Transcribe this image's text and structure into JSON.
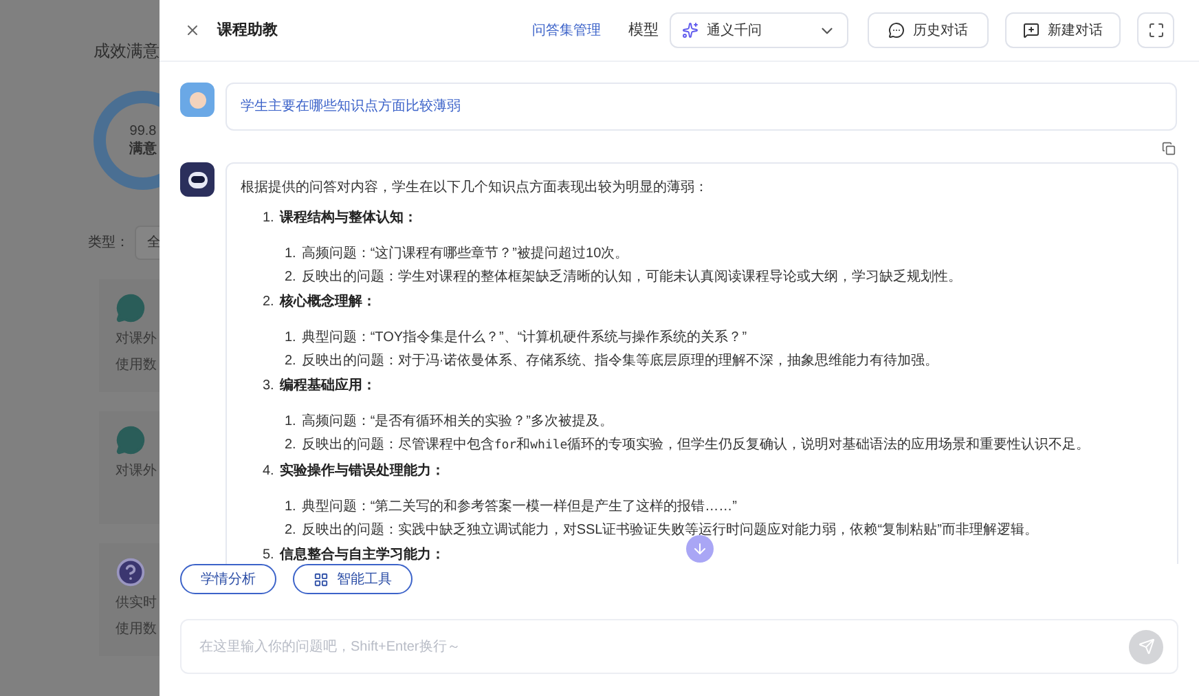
{
  "background_page": {
    "title": "成效满意",
    "donut_value": "99.8",
    "donut_label": "满意",
    "filter_label": "类型：",
    "filter_value": "全",
    "cards": [
      {
        "kind": "bot",
        "text": "对课外",
        "usage": "使用数"
      },
      {
        "kind": "bot",
        "text": "对课外"
      },
      {
        "kind": "question",
        "text": "供实时",
        "usage": "使用数"
      }
    ]
  },
  "drawer": {
    "title": "课程助教",
    "qa_link": "问答集管理",
    "model_label": "模型",
    "model": "通义千问",
    "history_button": "历史对话",
    "new_button": "新建对话"
  },
  "question": {
    "text": "学生主要在哪些知识点方面比较薄弱"
  },
  "answer": {
    "intro": "根据提供的问答对内容，学生在以下几个知识点方面表现出较为明显的薄弱：",
    "sections": [
      {
        "marker": "1.",
        "title": "课程结构与整体认知：",
        "children": [
          {
            "marker": "1.",
            "parts": [
              {
                "kind": "text",
                "text": "高频问题：“这门课程有哪些章节？”被提问超过10次。"
              }
            ]
          },
          {
            "marker": "2.",
            "parts": [
              {
                "kind": "text",
                "text": "反映出的问题：学生对课程的整体框架缺乏清晰的认知，可能未认真阅读课程导论或大纲，学习缺乏规划性。"
              }
            ]
          }
        ]
      },
      {
        "marker": "2.",
        "title": "核心概念理解：",
        "children": [
          {
            "marker": "1.",
            "parts": [
              {
                "kind": "text",
                "text": "典型问题：“TOY指令集是什么？”、“计算机硬件系统与操作系统的关系？”"
              }
            ]
          },
          {
            "marker": "2.",
            "parts": [
              {
                "kind": "text",
                "text": "反映出的问题：对于冯·诺依曼体系、存储系统、指令集等底层原理的理解不深，抽象思维能力有待加强。"
              }
            ]
          }
        ]
      },
      {
        "marker": "3.",
        "title": "编程基础应用：",
        "children": [
          {
            "marker": "1.",
            "parts": [
              {
                "kind": "text",
                "text": "高频问题：“是否有循环相关的实验？”多次被提及。"
              }
            ]
          },
          {
            "marker": "2.",
            "parts": [
              {
                "kind": "text",
                "text": "反映出的问题：尽管课程中包含"
              },
              {
                "kind": "code",
                "text": "for"
              },
              {
                "kind": "text",
                "text": "和"
              },
              {
                "kind": "code",
                "text": "while"
              },
              {
                "kind": "text",
                "text": "循环的专项实验，但学生仍反复确认，说明对基础语法的应用场景和重要性认识不足。"
              }
            ]
          }
        ]
      },
      {
        "marker": "4.",
        "title": "实验操作与错误处理能力：",
        "children": [
          {
            "marker": "1.",
            "parts": [
              {
                "kind": "text",
                "text": "典型问题：“第二关写的和参考答案一模一样但是产生了这样的报错……”"
              }
            ]
          },
          {
            "marker": "2.",
            "parts": [
              {
                "kind": "text",
                "text": "反映出的问题：实践中缺乏独立调试能力，对SSL证书验证失败等运行时问题应对能力弱，依赖“复制粘贴”而非理解逻辑。"
              }
            ]
          }
        ]
      },
      {
        "marker": "5.",
        "title": "信息整合与自主学习能力："
      }
    ]
  },
  "quick_actions": [
    {
      "kind": "plain",
      "label": "学情分析"
    },
    {
      "kind": "tools",
      "label": "智能工具"
    }
  ],
  "input": {
    "placeholder": "在这里输入你的问题吧，Shift+Enter换行～"
  }
}
